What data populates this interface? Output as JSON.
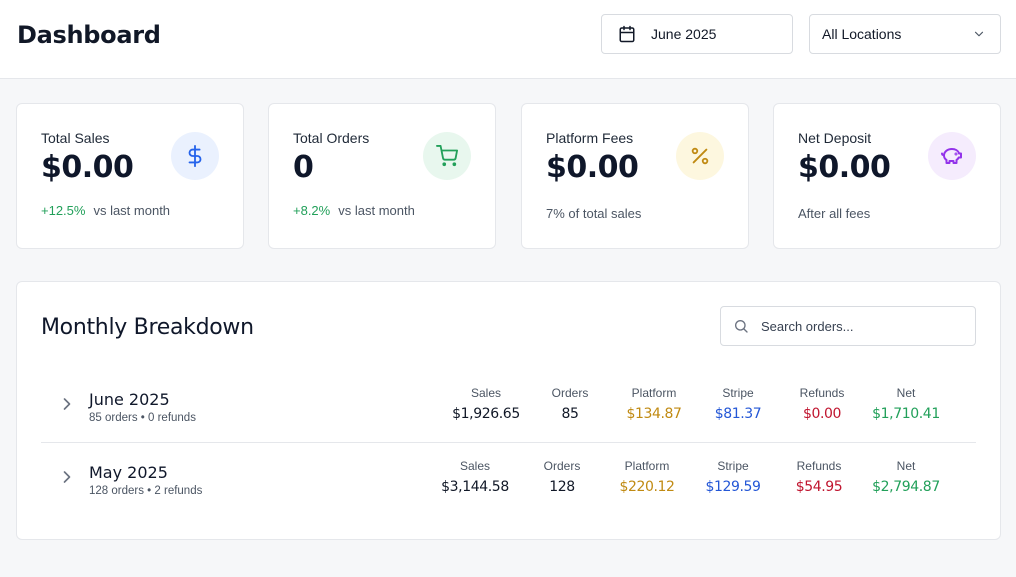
{
  "header": {
    "title": "Dashboard",
    "date_label": "June 2025",
    "location_label": "All Locations"
  },
  "icons": {
    "calendar": "calendar-icon",
    "chevron": "chevron-down-icon",
    "dollar": "dollar-icon",
    "cart": "cart-icon",
    "percent": "percent-icon",
    "piggy": "piggy-bank-icon",
    "search": "search-icon",
    "expand": "chevron-right-icon"
  },
  "colors": {
    "positive": "#22a05a",
    "platform": "#c08a12",
    "stripe": "#2457d6",
    "refunds": "#c0152f",
    "net": "#22a05a",
    "blue_badge": "#eaf1fe",
    "green_badge": "#e8f7ee",
    "amber_badge": "#fdf7df",
    "purple_badge": "#f5ecfd"
  },
  "cards": [
    {
      "label": "Total Sales",
      "value": "$0.00",
      "change": "+12.5%",
      "note": "vs last month"
    },
    {
      "label": "Total Orders",
      "value": "0",
      "change": "+8.2%",
      "note": "vs last month"
    },
    {
      "label": "Platform Fees",
      "value": "$0.00",
      "note": "7% of total sales"
    },
    {
      "label": "Net Deposit",
      "value": "$0.00",
      "note": "After all fees"
    }
  ],
  "breakdown": {
    "title": "Monthly Breakdown",
    "search_placeholder": "Search orders...",
    "headers": {
      "sales": "Sales",
      "orders": "Orders",
      "platform": "Platform",
      "stripe": "Stripe",
      "refunds": "Refunds",
      "net": "Net"
    },
    "rows": [
      {
        "month": "June 2025",
        "summary": "85 orders • 0 refunds",
        "sales": "$1,926.65",
        "orders": "85",
        "platform": "$134.87",
        "stripe": "$81.37",
        "refunds": "$0.00",
        "net": "$1,710.41"
      },
      {
        "month": "May 2025",
        "summary": "128 orders • 2 refunds",
        "sales": "$3,144.58",
        "orders": "128",
        "platform": "$220.12",
        "stripe": "$129.59",
        "refunds": "$54.95",
        "net": "$2,794.87"
      }
    ]
  }
}
